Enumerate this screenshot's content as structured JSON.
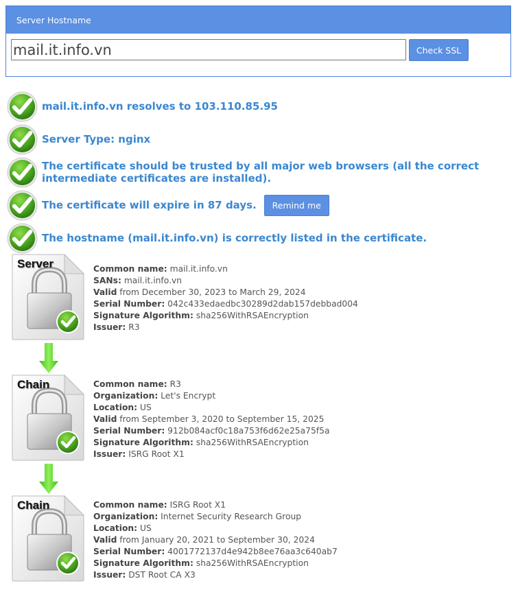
{
  "search": {
    "panel_title": "Server Hostname",
    "hostname_value": "mail.it.info.vn",
    "check_button": "Check SSL"
  },
  "results": [
    {
      "text": "mail.it.info.vn resolves to 103.110.85.95",
      "status": "pass"
    },
    {
      "text": "Server Type: nginx",
      "status": "pass"
    },
    {
      "text": "The certificate should be trusted by all major web browsers (all the correct intermediate certificates are installed).",
      "status": "pass"
    },
    {
      "text": "The certificate will expire in 87 days.",
      "status": "pass",
      "button": "Remind me"
    },
    {
      "text": "The hostname (mail.it.info.vn) is correctly listed in the certificate.",
      "status": "pass"
    }
  ],
  "certificates": [
    {
      "badge": "Server",
      "fields": [
        {
          "label": "Common name:",
          "value": " mail.it.info.vn"
        },
        {
          "label": "SANs:",
          "value": " mail.it.info.vn"
        },
        {
          "label": "Valid",
          "value": " from December 30, 2023 to March 29, 2024"
        },
        {
          "label": "Serial Number:",
          "value": " 042c433edaedbc30289d2dab157debbad004"
        },
        {
          "label": "Signature Algorithm:",
          "value": " sha256WithRSAEncryption"
        },
        {
          "label": "Issuer:",
          "value": " R3"
        }
      ]
    },
    {
      "badge": "Chain",
      "fields": [
        {
          "label": "Common name:",
          "value": " R3"
        },
        {
          "label": "Organization:",
          "value": " Let's Encrypt"
        },
        {
          "label": "Location:",
          "value": " US"
        },
        {
          "label": "Valid",
          "value": " from September 3, 2020 to September 15, 2025"
        },
        {
          "label": "Serial Number:",
          "value": " 912b084acf0c18a753f6d62e25a75f5a"
        },
        {
          "label": "Signature Algorithm:",
          "value": " sha256WithRSAEncryption"
        },
        {
          "label": "Issuer:",
          "value": " ISRG Root X1"
        }
      ]
    },
    {
      "badge": "Chain",
      "fields": [
        {
          "label": "Common name:",
          "value": " ISRG Root X1"
        },
        {
          "label": "Organization:",
          "value": " Internet Security Research Group"
        },
        {
          "label": "Location:",
          "value": " US"
        },
        {
          "label": "Valid",
          "value": " from January 20, 2021 to September 30, 2024"
        },
        {
          "label": "Serial Number:",
          "value": " 4001772137d4e942b8ee76aa3c640ab7"
        },
        {
          "label": "Signature Algorithm:",
          "value": " sha256WithRSAEncryption"
        },
        {
          "label": "Issuer:",
          "value": " DST Root CA X3"
        }
      ]
    }
  ],
  "colors": {
    "accent": "#5b90e2",
    "result_text": "#3a87d0",
    "pass_green": "#5cb82e"
  }
}
